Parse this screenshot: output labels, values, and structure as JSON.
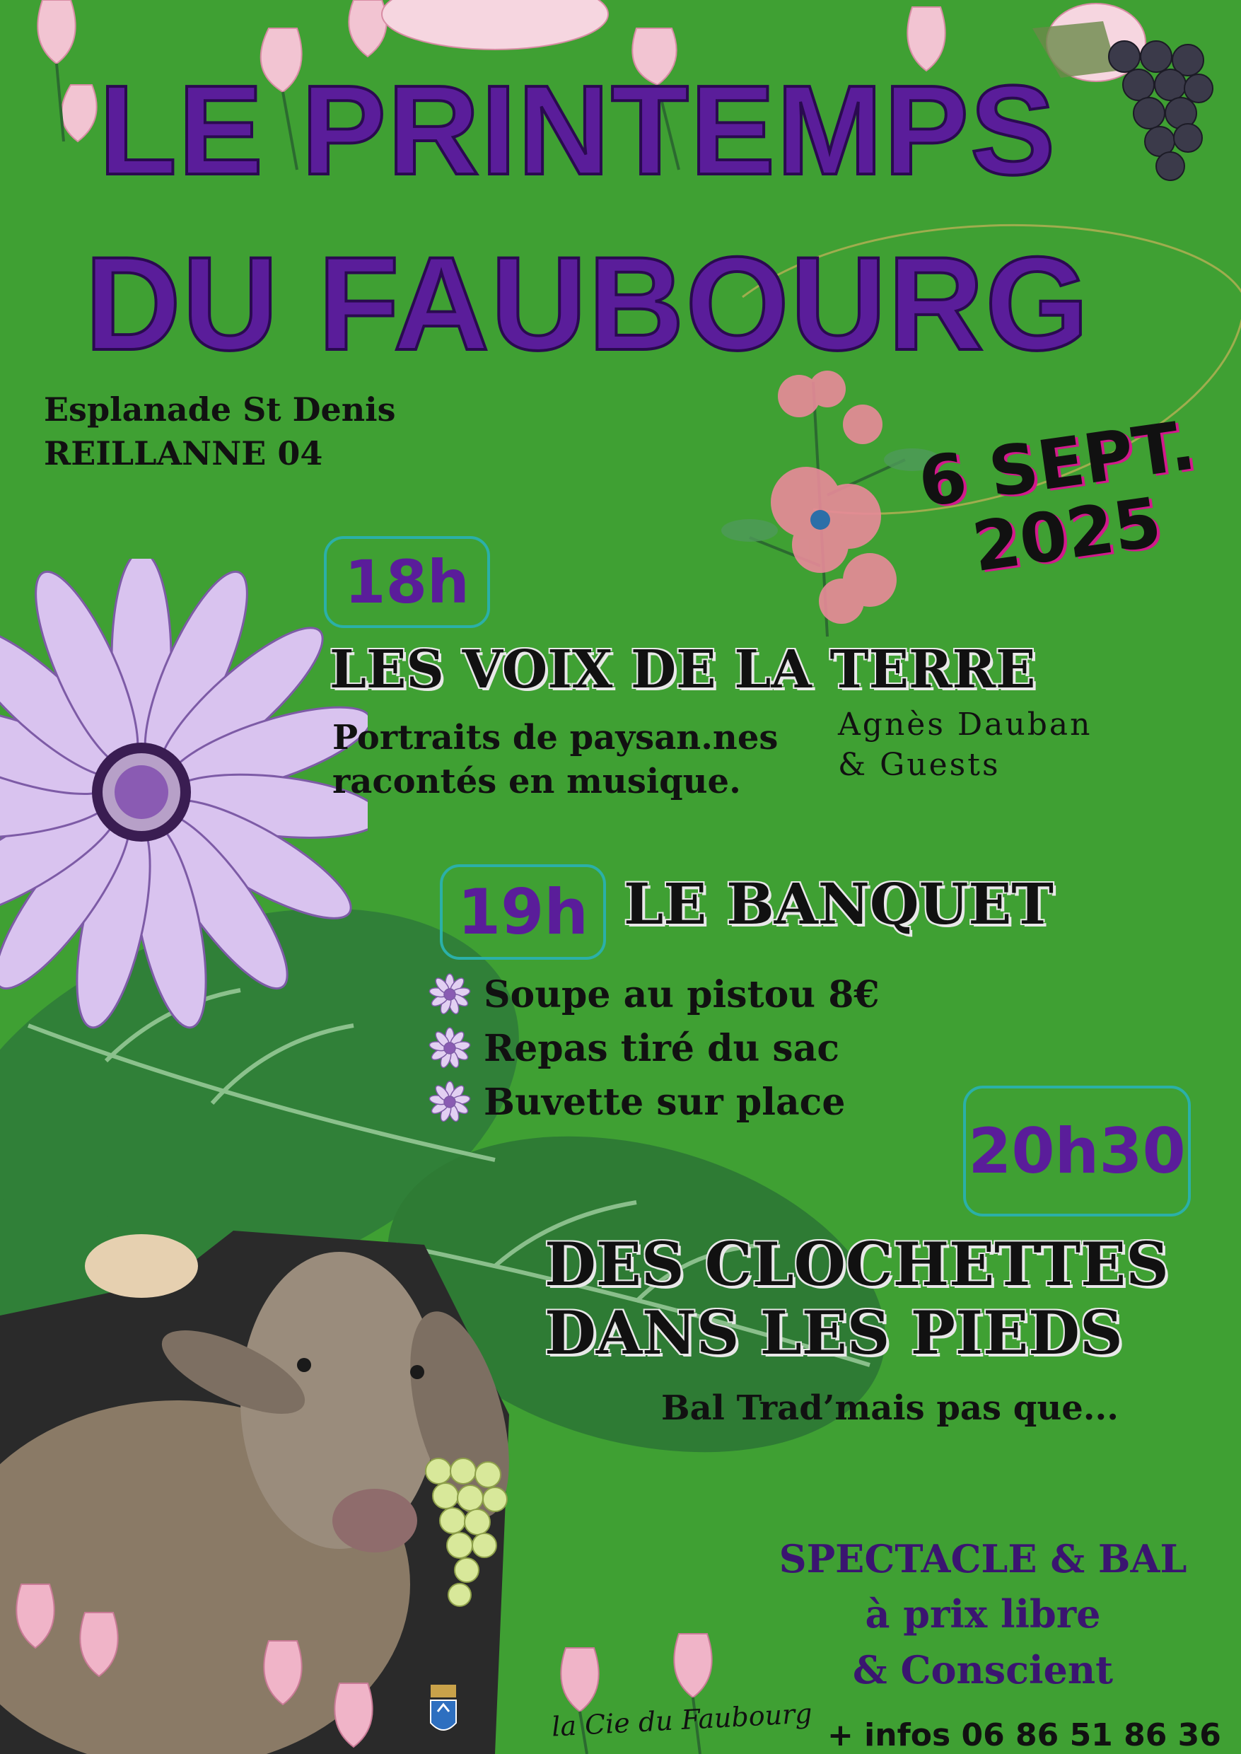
{
  "title": {
    "line1": "LE PRINTEMPS",
    "line2": "DU FAUBOURG"
  },
  "venue": {
    "line1": "Esplanade St Denis",
    "line2": "REILLANNE 04"
  },
  "date": {
    "line1": "6 SEPT.",
    "line2": "2025"
  },
  "events": [
    {
      "time": "18h",
      "title": "LES VOIX DE LA TERRE",
      "description": [
        "Portraits  de paysan.nes",
        "racontés en musique."
      ],
      "artist": [
        "Agnès Dauban",
        "& Guests"
      ]
    },
    {
      "time": "19h",
      "title": "LE BANQUET",
      "items": [
        "Soupe au pistou  8€",
        "Repas tiré du sac",
        "Buvette sur place"
      ]
    },
    {
      "time": "20h30",
      "title": [
        "DES CLOCHETTES",
        "DANS LES PIEDS"
      ],
      "subtitle": "Bal Trad’mais pas que..."
    }
  ],
  "footer": {
    "pricing": [
      "SPECTACLE & BAL",
      "à prix libre",
      "& Conscient"
    ],
    "infos": "+ infos 06 86 51 86 36",
    "signature": "la Cie du Faubourg"
  },
  "colors": {
    "background": "#3fa033",
    "title_purple": "#5a1d9a",
    "date_shadow": "#d2198c",
    "time_box_border": "#2bb0a8",
    "footer_purple": "#3a1570"
  },
  "icons": [
    "daisy-bullet-icon",
    "coat-of-arms-icon"
  ]
}
